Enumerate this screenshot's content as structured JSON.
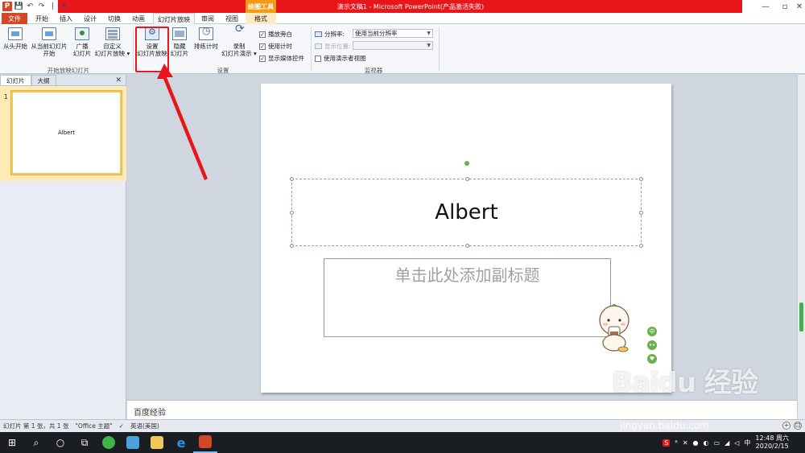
{
  "window": {
    "title": "演示文稿1 - Microsoft PowerPoint(产品激活失败)",
    "context_tool_label": "绘图工具",
    "logo_letter": "P",
    "qat": {
      "save": "💾",
      "undo": "↶",
      "redo": "↷",
      "separator": "|",
      "more": "▾"
    },
    "controls": {
      "minimize": "—",
      "restore": "▫",
      "close": "✕"
    }
  },
  "tabs": [
    {
      "label": "文件",
      "name": "file"
    },
    {
      "label": "开始",
      "name": "home"
    },
    {
      "label": "插入",
      "name": "insert"
    },
    {
      "label": "设计",
      "name": "design"
    },
    {
      "label": "切换",
      "name": "transitions"
    },
    {
      "label": "动画",
      "name": "animations"
    },
    {
      "label": "幻灯片放映",
      "name": "slideshow"
    },
    {
      "label": "审阅",
      "name": "review"
    },
    {
      "label": "视图",
      "name": "view"
    },
    {
      "label": "格式",
      "name": "format"
    }
  ],
  "ribbon": {
    "start_group": {
      "from_beginning": "从头开始",
      "from_current_1": "从当前幻灯片",
      "from_current_2": "开始",
      "broadcast_1": "广播",
      "broadcast_2": "幻灯片",
      "custom_1": "自定义",
      "custom_2": "幻灯片放映 ▾",
      "label": "开始放映幻灯片"
    },
    "setup_group": {
      "setup_1": "设置",
      "setup_2": "幻灯片放映",
      "hide_1": "隐藏",
      "hide_2": "幻灯片",
      "rehearse": "排练计时",
      "record_1": "录制",
      "record_2": "幻灯片演示 ▾",
      "play_narrations": "播放旁白",
      "use_timings": "使用计时",
      "show_media_controls": "显示媒体控件",
      "label": "设置"
    },
    "monitors_group": {
      "resolution_label": "分辨率:",
      "resolution_value": "使用当前分辨率",
      "show_on_label": "显示位置:",
      "show_on_value": "",
      "presenter_view": "使用演示者视图",
      "label": "监视器"
    }
  },
  "left_pane": {
    "tab_slides": "幻灯片",
    "tab_outline": "大纲",
    "close": "✕",
    "thumbnail_number": "1",
    "thumbnail_title": "Albert"
  },
  "slide": {
    "title": "Albert",
    "subtitle_placeholder": "单击此处添加副标题",
    "bubbles": [
      "中",
      "••",
      "♥"
    ]
  },
  "notes": {
    "text": "百度经验"
  },
  "status": {
    "slide_info": "幻灯片 第 1 张，共 1 张",
    "theme": "\"Office 主题\"",
    "language": "英语(美国)"
  },
  "taskbar": {
    "time": "12:48 周六",
    "date": "2020/2/15",
    "tray_icons": [
      "S",
      "ᴿ",
      "✕",
      "●",
      "◐",
      "▭",
      "◢",
      "◁",
      "中"
    ]
  },
  "watermark": {
    "main": "Baidu 经验",
    "url": "jingyan.baidu.com"
  },
  "colors": {
    "file_tab": "#d24726",
    "title_bar": "#e8161b",
    "context_tab": "#f49b16",
    "highlight": "#e8161b"
  }
}
